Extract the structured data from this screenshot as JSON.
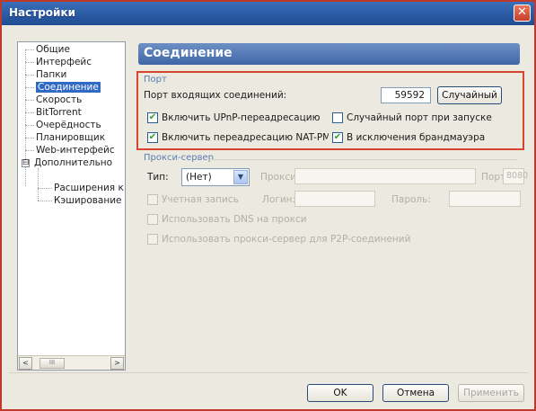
{
  "window": {
    "title": "Настройки",
    "close_glyph": "✕"
  },
  "tree": {
    "items": [
      {
        "label": "Общие"
      },
      {
        "label": "Интерфейс"
      },
      {
        "label": "Папки"
      },
      {
        "label": "Соединение",
        "selected": true
      },
      {
        "label": "Скорость"
      },
      {
        "label": "BitTorrent"
      },
      {
        "label": "Очерёдность"
      },
      {
        "label": "Планировщик"
      },
      {
        "label": "Web-интерфейс"
      },
      {
        "label": "Дополнительно",
        "expander": "⊟"
      },
      {
        "label": "Расширения к"
      },
      {
        "label": "Кэширование"
      }
    ],
    "scroll_left": "<",
    "scroll_right": ">",
    "scroll_thumb": "III"
  },
  "panel": {
    "header": "Соединение",
    "port_group": {
      "title": "Порт",
      "incoming_label": "Порт входящих соединений:",
      "incoming_value": "59592",
      "random_button": "Случайный",
      "upnp_label": "Включить UPnP-переадресацию",
      "upnp_checked": true,
      "random_on_start_label": "Случайный порт при запуске",
      "random_on_start_checked": false,
      "natpmp_label": "Включить переадресацию NAT-PM",
      "natpmp_checked": true,
      "firewall_label": "В исключения брандмауэра",
      "firewall_checked": true
    },
    "proxy_group": {
      "title": "Прокси-сервер",
      "type_label": "Тип:",
      "type_value": "(Нет)",
      "proxy_label": "Прокси:",
      "proxy_value": "",
      "port_label": "Порт:",
      "port_value": "8080",
      "auth_label": "Учетная запись",
      "login_label": "Логин:",
      "password_label": "Пароль:",
      "dns_label": "Использовать DNS на прокси",
      "p2p_label": "Использовать прокси-сервер для P2P-соединений"
    }
  },
  "buttons": {
    "ok": "OK",
    "cancel": "Отмена",
    "apply": "Применить"
  },
  "colors": {
    "highlight_border": "#d8442c",
    "title_bar": "#2a5aa3",
    "header_bg": "#3f66a8",
    "check_mark": "#2f9e2f"
  }
}
